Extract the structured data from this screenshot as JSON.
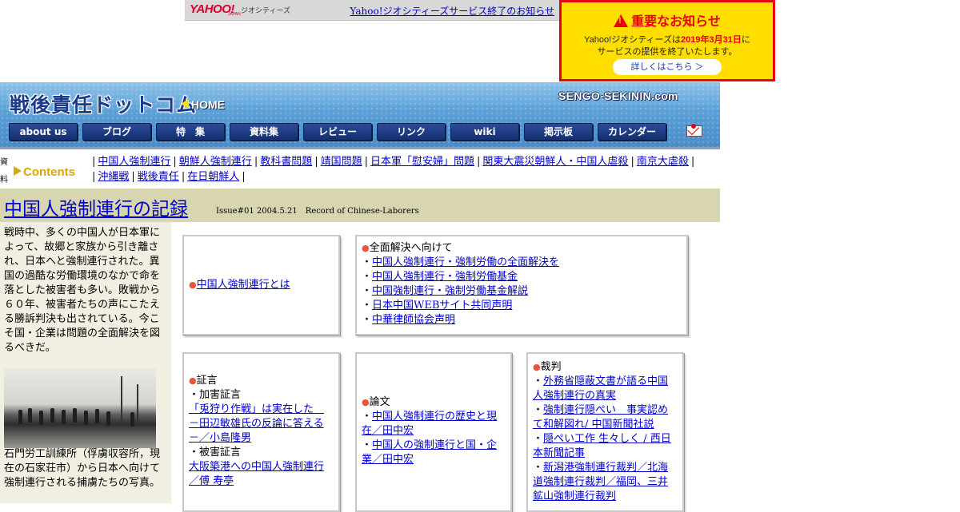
{
  "yahoo_bar": {
    "logo": "YAHOO!",
    "logo_sub": "JAPAN",
    "service": "ジオシティーズ",
    "notice_link": "Yahoo!ジオシティーズサービス終了のお知らせ"
  },
  "notice": {
    "title": "重要なお知らせ",
    "line1_pre": "Yahoo!ジオシティーズは",
    "line1_date": "2019年3月31日",
    "line1_post": "に",
    "line2": "サービスの提供を終了いたします。",
    "button": "詳しくはこちら ＞"
  },
  "header": {
    "logo": "戦後責任ドットコム",
    "home": "HOME",
    "domain": "SENGO-SEKININ.com",
    "nav": [
      "about us",
      "ブログ",
      "特　集",
      "資料集",
      "レビュー",
      "リンク",
      "wiki",
      "掲示板",
      "カレンダー"
    ]
  },
  "contents": {
    "side_label": "資料集",
    "label": "Contents",
    "links": [
      "中国人強制連行",
      "朝鮮人強制連行",
      "教科書問題",
      "靖国問題",
      "日本軍「慰安婦」問題",
      "関東大震災朝鮮人・中国人虐殺",
      "南京大虐殺",
      "沖縄戦",
      "戦後責任",
      "在日朝鮮人"
    ]
  },
  "title_band": {
    "title": "中国人強制連行の記録",
    "issue": "Issue#01 2004.5.21　Record of Chinese-Laborers"
  },
  "left": {
    "intro": "戦時中、多くの中国人が日本軍によって、故郷と家族から引き離され、日本へと強制連行された。異国の過酷な労働環境のなかで命を落とした被害者も多い。敗戦から６０年、被害者たちの声にこたえる勝訴判決も出されている。今こそ国・企業は問題の全面解決を図るべきだ。",
    "caption": "石門労工訓練所（俘虜収容所，現在の石家荘市）から日本へ向けて強制連行される捕虜たちの写真。"
  },
  "boxes": {
    "about_link": "中国人強制連行とは",
    "resolution": {
      "heading": "全面解決へ向けて",
      "links": [
        "中国人強制連行・強制労働の全面解決を",
        "中国人強制連行・強制労働基金",
        "中国強制連行・強制労働基金解説",
        "日本中国WEBサイト共同声明",
        "中華律師協会声明"
      ]
    },
    "testimony": {
      "heading": "証言",
      "sub1": "加害証言",
      "link1": "「兎狩り作戦」は実在した　－田辺敏雄氏の反論に答える－／小島隆男",
      "sub2": "被害証言",
      "link2": "大阪築港への中国人強制連行／傅 寿亭"
    },
    "papers": {
      "heading": "論文",
      "links": [
        "中国人強制連行の歴史と現在／田中宏",
        "中国人の強制連行と国・企業／田中宏"
      ]
    },
    "trials": {
      "heading": "裁判",
      "links": [
        "外務省隠蔽文書が語る中国人強制連行の真実",
        "強制連行隠ぺい　事実認めて和解図れ/ 中国新聞社説",
        "隠ぺい工作 生々しく / 西日本新聞記事",
        "新潟港強制連行裁判／北海道強制連行裁判／福岡、三井鉱山強制連行裁判"
      ]
    }
  }
}
